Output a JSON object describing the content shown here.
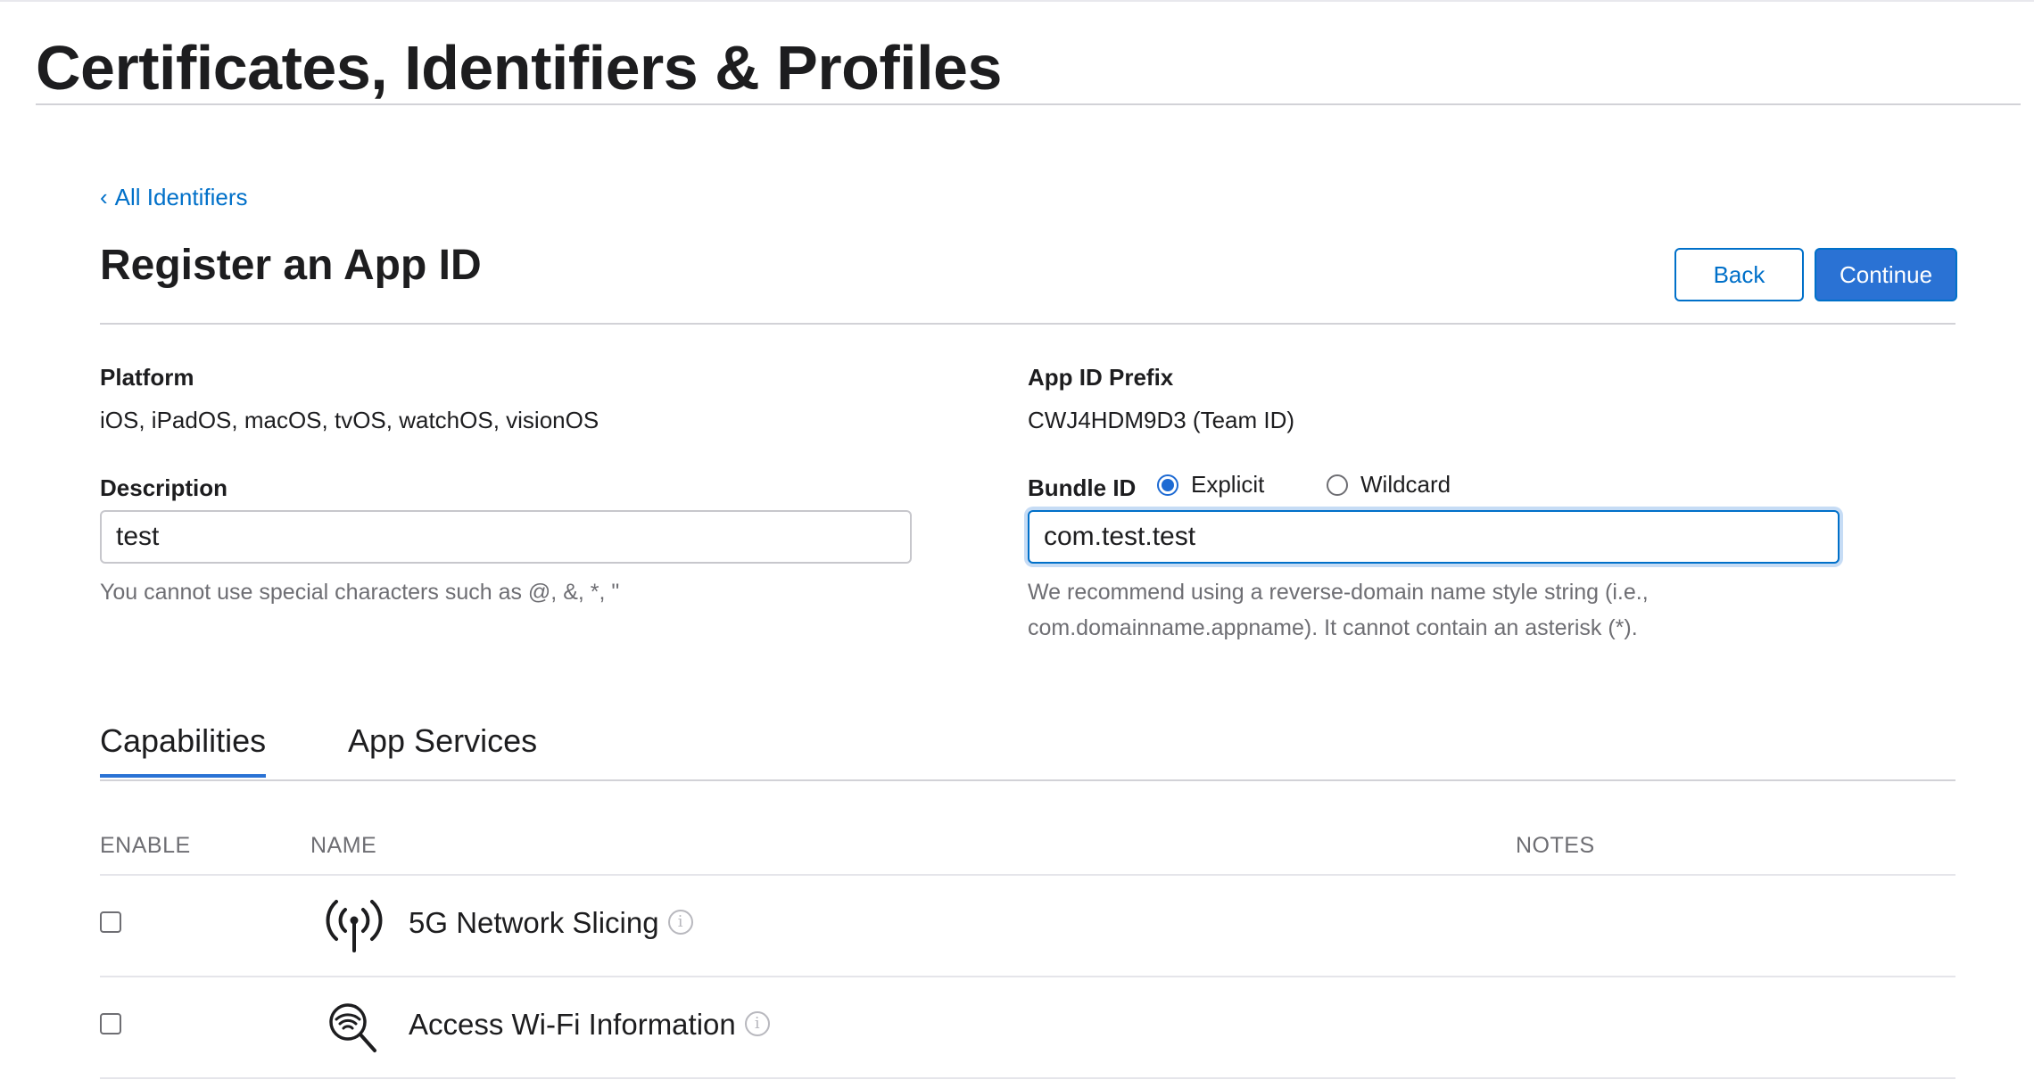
{
  "page": {
    "title": "Certificates, Identifiers & Profiles"
  },
  "nav": {
    "back_link_chevron": "‹",
    "back_link_label": "All Identifiers"
  },
  "form": {
    "title": "Register an App ID",
    "back_button": "Back",
    "continue_button": "Continue",
    "platform": {
      "label": "Platform",
      "value": "iOS, iPadOS, macOS, tvOS, watchOS, visionOS"
    },
    "app_id_prefix": {
      "label": "App ID Prefix",
      "value": "CWJ4HDM9D3 (Team ID)"
    },
    "description": {
      "label": "Description",
      "value": "test",
      "help": "You cannot use special characters such as @, &, *, \""
    },
    "bundle_id": {
      "label": "Bundle ID",
      "options": [
        {
          "label": "Explicit",
          "selected": true
        },
        {
          "label": "Wildcard",
          "selected": false
        }
      ],
      "value": "com.test.test",
      "help_line1": "We recommend using a reverse-domain name style string (i.e.,",
      "help_line2": "com.domainname.appname). It cannot contain an asterisk (*)."
    }
  },
  "tabs": [
    {
      "label": "Capabilities",
      "active": true
    },
    {
      "label": "App Services",
      "active": false
    }
  ],
  "table": {
    "columns": {
      "enable": "ENABLE",
      "name": "NAME",
      "notes": "NOTES"
    },
    "rows": [
      {
        "name": "5G Network Slicing",
        "icon": "antenna-icon",
        "enabled": false,
        "info_glyph": "i"
      },
      {
        "name": "Access Wi-Fi Information",
        "icon": "wifi-search-icon",
        "enabled": false,
        "info_glyph": "i"
      }
    ]
  },
  "colors": {
    "accent": "#2a72d4",
    "link": "#0070c9",
    "text": "#1d1d1f",
    "muted": "#6e6e73",
    "border": "#d2d2d7"
  }
}
